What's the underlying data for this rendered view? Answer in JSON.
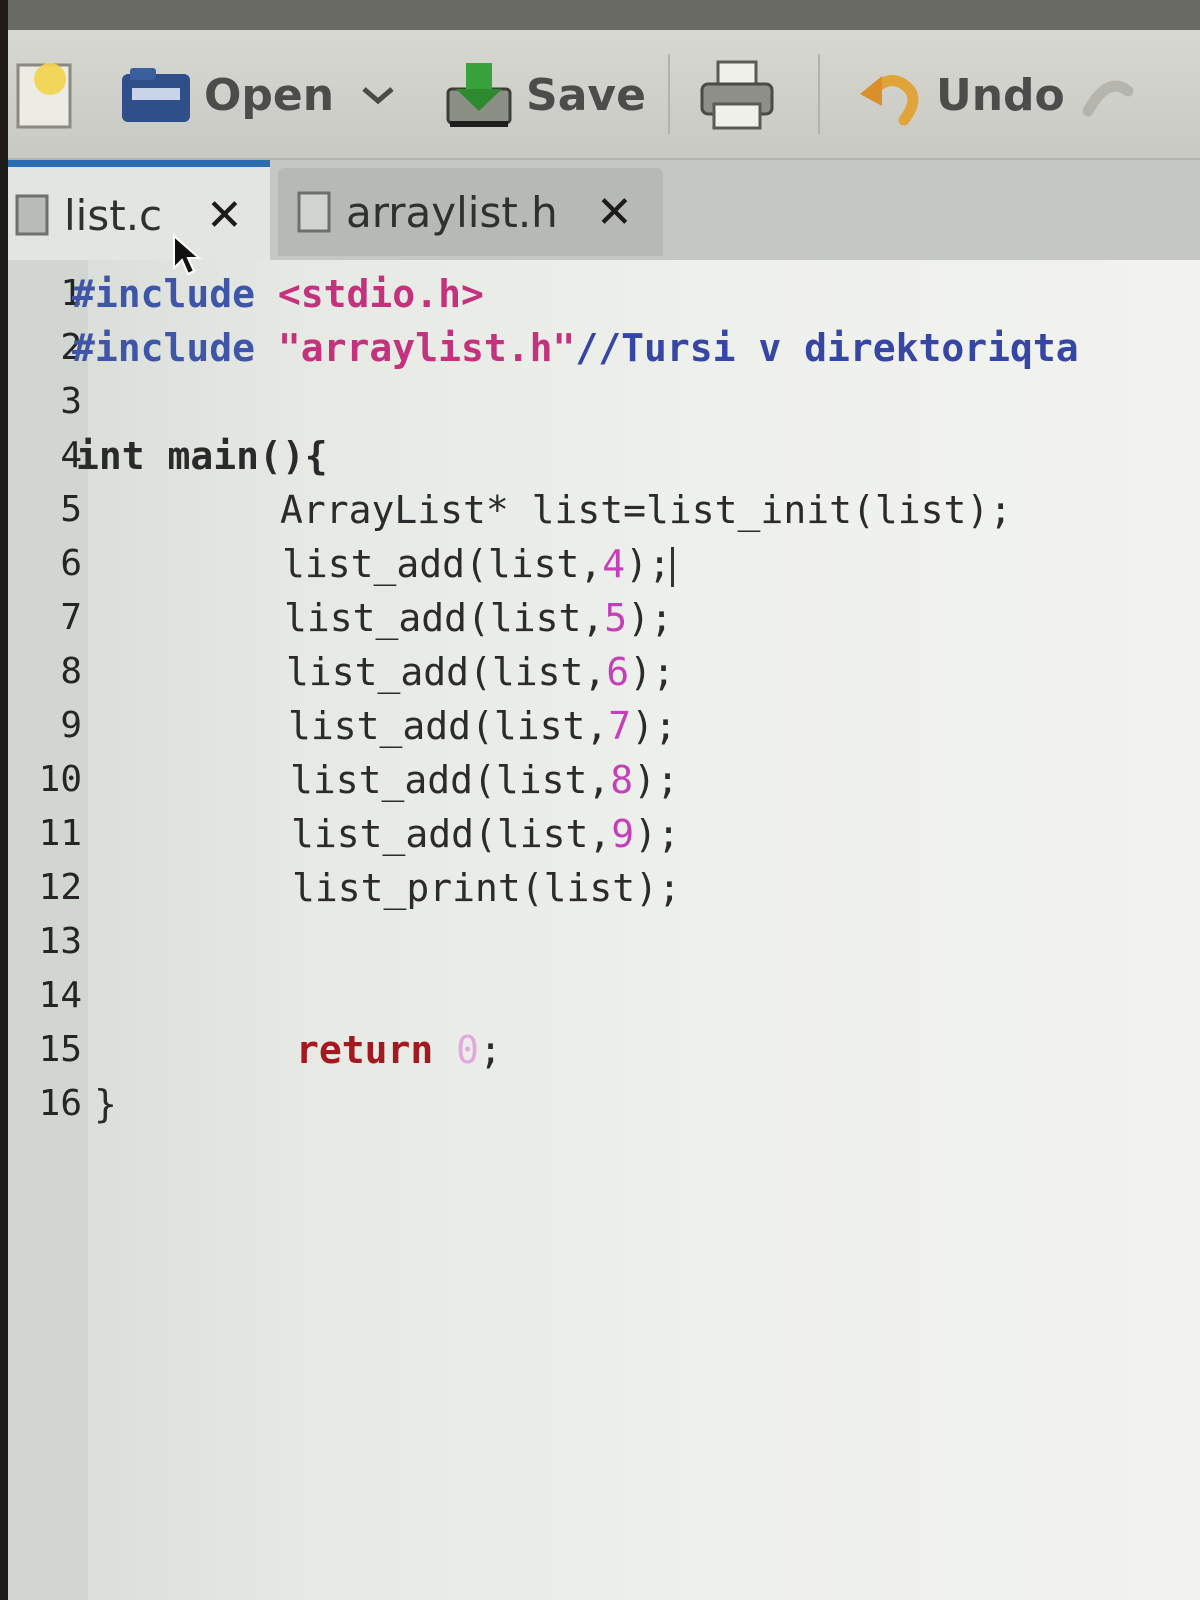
{
  "toolbar": {
    "open_label": "Open",
    "save_label": "Save",
    "undo_label": "Undo"
  },
  "tabs": [
    {
      "label": "list.c",
      "active": true
    },
    {
      "label": "arraylist.h",
      "active": false
    }
  ],
  "editor": {
    "line_numbers": [
      "1",
      "2",
      "3",
      "4",
      "5",
      "6",
      "7",
      "8",
      "9",
      "10",
      "11",
      "12",
      "13",
      "14",
      "15",
      "16"
    ],
    "lines": {
      "l1_directive": "#include",
      "l1_header": "<stdio.h>",
      "l2_directive": "#include",
      "l2_header": "\"arraylist.h\"",
      "l2_comment": "//Tursi v direktoriqta",
      "l4_type": "int",
      "l4_rest": "main(){",
      "l5": "ArrayList* list=list_init(list);",
      "l6_pre": "list_add(list,",
      "l6_num": "4",
      "l6_post": ");",
      "l7_pre": "list_add(list,",
      "l7_num": "5",
      "l7_post": ");",
      "l8_pre": "list_add(list,",
      "l8_num": "6",
      "l8_post": ");",
      "l9_pre": "list_add(list,",
      "l9_num": "7",
      "l9_post": ");",
      "l10_pre": "list_add(list,",
      "l10_num": "8",
      "l10_post": ");",
      "l11_pre": "list_add(list,",
      "l11_num": "9",
      "l11_post": ");",
      "l12": "list_print(list);",
      "l15_kw": "return",
      "l15_num": "0",
      "l15_post": ";",
      "l16": "}"
    }
  },
  "colors": {
    "preprocessor": "#3f56a8",
    "string": "#c4317c",
    "number": "#c53fb8",
    "return_keyword": "#a3191f",
    "active_tab_accent": "#2a6db0"
  }
}
